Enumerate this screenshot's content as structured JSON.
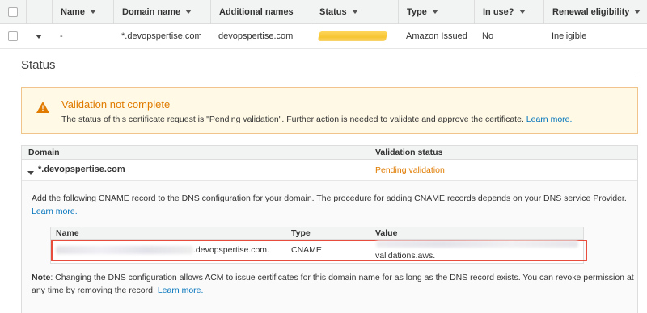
{
  "certificates_table": {
    "columns": [
      {
        "label": "Name",
        "sortable": true
      },
      {
        "label": "Domain name",
        "sortable": true
      },
      {
        "label": "Additional names",
        "sortable": false
      },
      {
        "label": "Status",
        "sortable": true
      },
      {
        "label": "Type",
        "sortable": true
      },
      {
        "label": "In use?",
        "sortable": true
      },
      {
        "label": "Renewal eligibility",
        "sortable": true
      }
    ],
    "row": {
      "name": "-",
      "domain_name": "*.devopspertise.com",
      "additional_names": "devopspertise.com",
      "status": "",
      "type": "Amazon Issued",
      "in_use": "No",
      "renewal_eligibility": "Ineligible"
    }
  },
  "status_section": {
    "title": "Status",
    "alert": {
      "icon": "warning-icon",
      "title": "Validation not complete",
      "text": "The status of this certificate request is \"Pending validation\". Further action is needed to validate and approve the certificate.",
      "link": "Learn more."
    },
    "domain_table": {
      "columns": [
        "Domain",
        "Validation status"
      ],
      "domain": "*.devopspertise.com",
      "validation_status": "Pending validation",
      "instructions": "Add the following CNAME record to the DNS configuration for your domain. The procedure for adding CNAME records depends on your DNS service Provider.",
      "instructions_link": "Learn more.",
      "cname_table": {
        "columns": [
          "Name",
          "Type",
          "Value"
        ],
        "name_suffix": ".devopspertise.com.",
        "type": "CNAME",
        "value_suffix": "validations.aws."
      },
      "note_label": "Note",
      "note_text": ": Changing the DNS configuration allows ACM to issue certificates for this domain name for as long as the DNS record exists. You can revoke permission at any time by removing the record.",
      "note_link": "Learn more."
    }
  },
  "colors": {
    "warning": "#e07b00",
    "link": "#0073bb",
    "alert_bg": "#fff9e6",
    "highlight": "#e74c3c"
  }
}
